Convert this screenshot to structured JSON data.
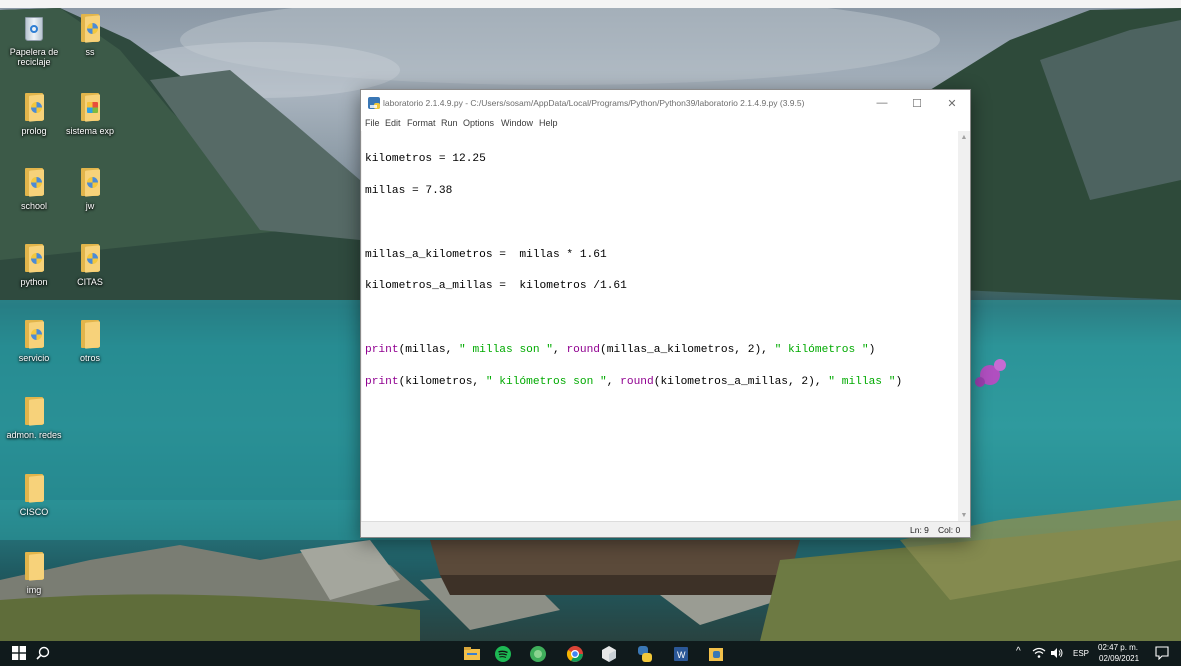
{
  "desktop": {
    "icons": [
      {
        "label": "Papelera de reciclaje",
        "icon": "recycle-bin-icon"
      },
      {
        "label": "ss",
        "icon": "folder-icon"
      },
      {
        "label": "prolog",
        "icon": "folder-icon"
      },
      {
        "label": "sistema exp",
        "icon": "folder-icon"
      },
      {
        "label": "school",
        "icon": "folder-icon"
      },
      {
        "label": "jw",
        "icon": "folder-icon"
      },
      {
        "label": "python",
        "icon": "folder-icon"
      },
      {
        "label": "CITAS",
        "icon": "folder-icon"
      },
      {
        "label": "servicio",
        "icon": "folder-icon"
      },
      {
        "label": "otros",
        "icon": "folder-icon"
      },
      {
        "label": "admon. redes",
        "icon": "folder-icon"
      },
      {
        "label": "CISCO",
        "icon": "folder-icon"
      },
      {
        "label": "img",
        "icon": "folder-icon"
      }
    ]
  },
  "window": {
    "title": "laboratorio 2.1.4.9.py - C:/Users/sosam/AppData/Local/Programs/Python/Python39/laboratorio 2.1.4.9.py (3.9.5)",
    "controls": {
      "minimize": "—",
      "maximize": "☐",
      "close": "✕"
    },
    "menu": [
      "File",
      "Edit",
      "Format",
      "Run",
      "Options",
      "Window",
      "Help"
    ],
    "code": {
      "line1": "kilometros = 12.25",
      "line2": "millas = 7.38",
      "line3": "",
      "line4": "millas_a_kilometros =  millas * 1.61",
      "line5": "kilometros_a_millas =  kilometros /1.61",
      "line6": "",
      "line7": {
        "fn": "print",
        "a": "(millas, ",
        "s1": "\" millas son \"",
        "b": ", ",
        "fn2": "round",
        "c": "(millas_a_kilometros, 2), ",
        "s2": "\" kilómetros \"",
        "d": ")"
      },
      "line8": {
        "fn": "print",
        "a": "(kilometros, ",
        "s1": "\" kilómetros son \"",
        "b": ", ",
        "fn2": "round",
        "c": "(kilometros_a_millas, 2), ",
        "s2": "\" millas \"",
        "d": ")"
      }
    },
    "status": {
      "line": "Ln: 9",
      "col": "Col: 0"
    }
  },
  "taskbar": {
    "tray": {
      "chevron": "^",
      "language": "ESP",
      "time": "02:47 p. m.",
      "date": "02/09/2021"
    }
  },
  "colors": {
    "keyword": "#900090",
    "string": "#00aa00",
    "taskbar": "#0c1618"
  }
}
